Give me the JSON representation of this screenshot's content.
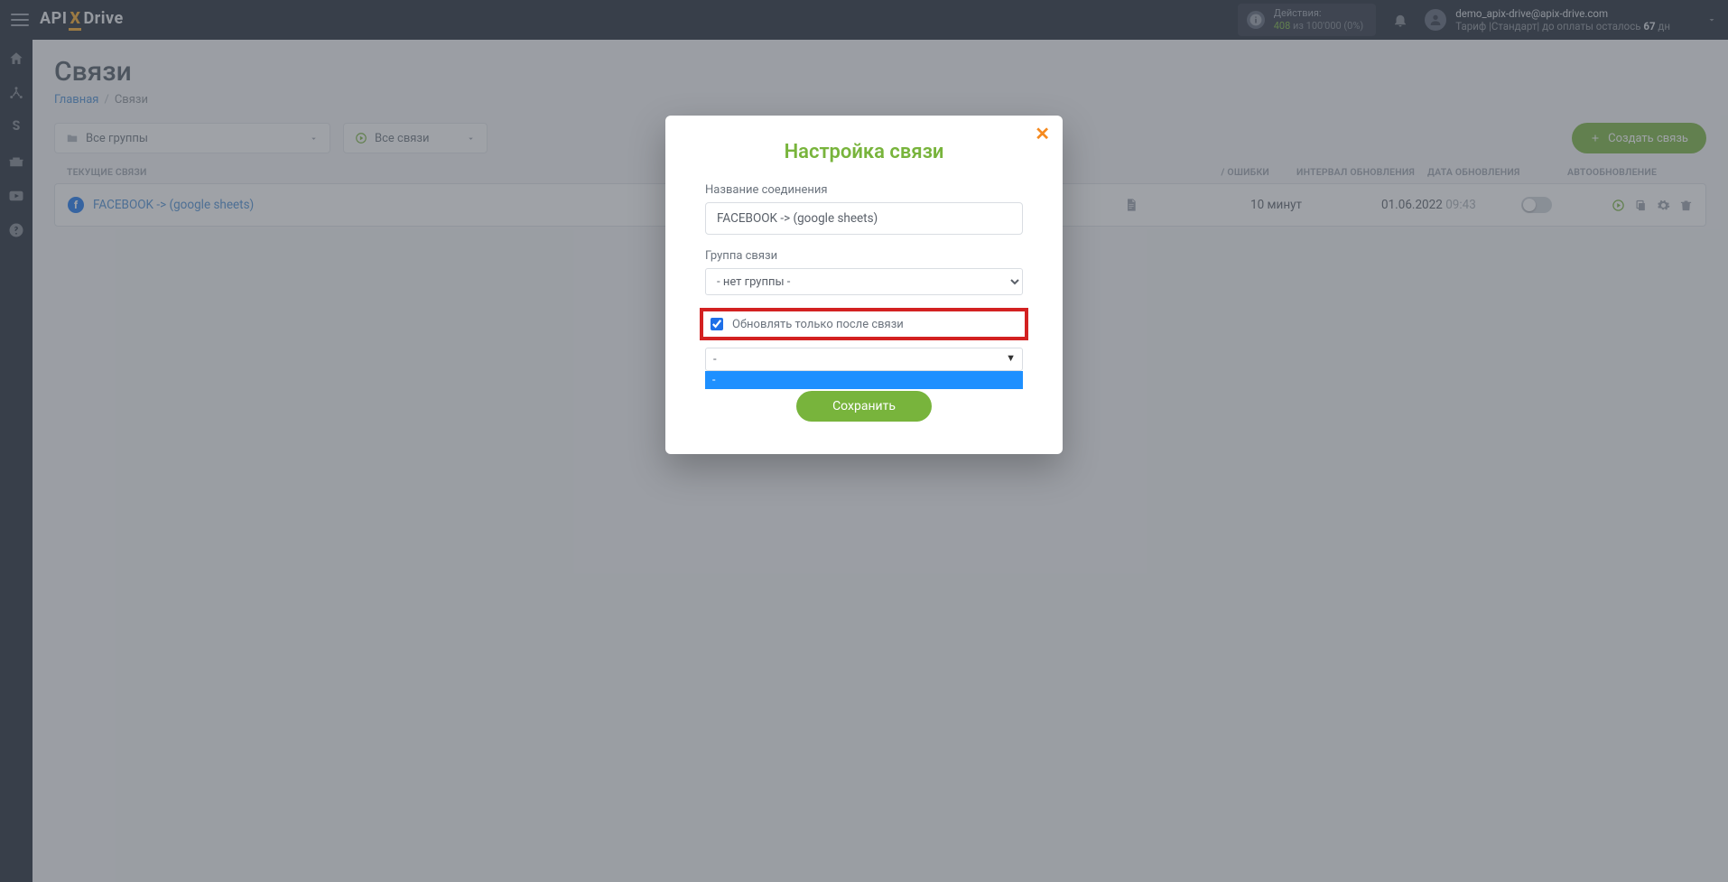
{
  "brand": {
    "api": "API",
    "x": "X",
    "drive": "Drive"
  },
  "header": {
    "actions_label": "Действия:",
    "actions_used": "408",
    "actions_of": "из",
    "actions_total": "100'000",
    "actions_pct": "(0%)",
    "user_email": "demo_apix-drive@apix-drive.com",
    "plan_prefix": "Тариф |",
    "plan_name": "Стандарт",
    "plan_mid": "| до оплаты осталось ",
    "plan_days": "67",
    "plan_suffix": " дн"
  },
  "page": {
    "title": "Связи",
    "crumb_home": "Главная",
    "crumb_current": "Связи"
  },
  "filters": {
    "groups_label": "Все группы",
    "conns_label": "Все связи",
    "create_btn": "Создать связь"
  },
  "table_head": {
    "name": "ТЕКУЩИЕ СВЯЗИ",
    "errors": "/ ОШИБКИ",
    "interval": "ИНТЕРВАЛ ОБНОВЛЕНИЯ",
    "date": "ДАТА ОБНОВЛЕНИЯ",
    "auto": "АВТООБНОВЛЕНИЕ"
  },
  "row": {
    "name": "FACEBOOK -> (google sheets)",
    "interval": "10 минут",
    "date": "01.06.2022",
    "time": "09:43"
  },
  "modal": {
    "title": "Настройка связи",
    "name_label": "Название соединения",
    "name_value": "FACEBOOK -> (google sheets)",
    "group_label": "Группа связи",
    "group_value": "- нет группы -",
    "checkbox_label": "Обновлять только после связи",
    "dep_value": "-",
    "dep_option": "-",
    "save_btn": "Сохранить"
  }
}
